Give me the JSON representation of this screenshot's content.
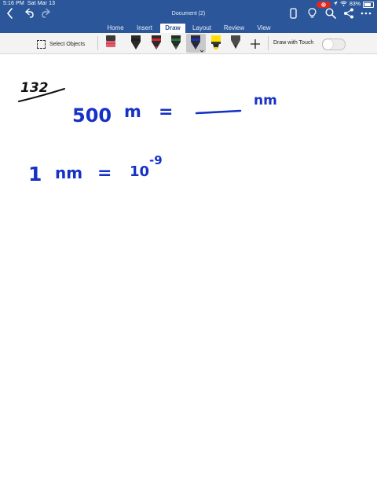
{
  "status": {
    "time": "5:16 PM",
    "date": "Sat Mar 13",
    "battery_percent": "83%",
    "battery_level": 0.83,
    "recording_indicator": "record-icon",
    "wifi_icon": "wifi-icon"
  },
  "document": {
    "title": "Document (2)"
  },
  "nav_icons": {
    "back": "chevron-left-icon",
    "undo": "undo-icon",
    "redo": "redo-icon",
    "device": "device-icon",
    "ideas": "lightbulb-icon",
    "search": "search-icon",
    "share": "share-icon",
    "more": "more-icon"
  },
  "tabs": [
    {
      "label": "Home",
      "active": false
    },
    {
      "label": "Insert",
      "active": false
    },
    {
      "label": "Draw",
      "active": true
    },
    {
      "label": "Layout",
      "active": false
    },
    {
      "label": "Review",
      "active": false
    },
    {
      "label": "View",
      "active": false
    }
  ],
  "ribbon": {
    "select_objects_label": "Select Objects",
    "draw_with_touch_label": "Draw with Touch",
    "draw_with_touch_on": false,
    "add_tool_icon": "plus-icon",
    "tools": [
      {
        "name": "eraser",
        "color": "#e05a6a"
      },
      {
        "name": "pen-black",
        "color": "#1f1f1f"
      },
      {
        "name": "pen-red",
        "color": "#d8242b"
      },
      {
        "name": "pen-green",
        "color": "#1f7a3a"
      },
      {
        "name": "pen-blue",
        "color": "#1631c6",
        "selected": true
      },
      {
        "name": "highlighter-yellow",
        "color": "#ffe100"
      },
      {
        "name": "pencil-gray",
        "color": "#5a5a5a"
      }
    ]
  },
  "ink": {
    "color": "#1631c6",
    "black_color": "#111111",
    "problem_number": "132",
    "line1_value": "500",
    "line1_unit": "m",
    "equals": "=",
    "blank": "___",
    "line1_target_unit": "nm",
    "line2_one": "1",
    "line2_unit": "nm",
    "line2_base": "10",
    "line2_exponent": "-9"
  }
}
